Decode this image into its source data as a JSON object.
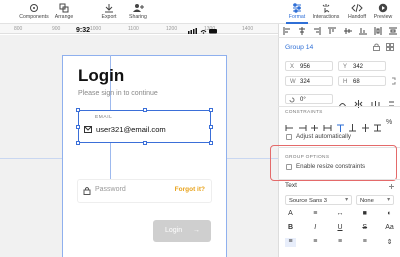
{
  "toolbar": {
    "items": [
      {
        "label": "Components",
        "icon": "components-icon"
      },
      {
        "label": "Arrange",
        "icon": "arrange-icon"
      },
      {
        "label": "Export",
        "icon": "export-icon"
      },
      {
        "label": "Sharing",
        "icon": "sharing-icon"
      },
      {
        "label": "Format",
        "icon": "format-icon"
      },
      {
        "label": "Interactions",
        "icon": "interactions-icon"
      },
      {
        "label": "Handoff",
        "icon": "handoff-icon"
      },
      {
        "label": "Preview",
        "icon": "preview-icon"
      }
    ],
    "active": "Format",
    "accent_color": "#2f6fd6"
  },
  "ruler": {
    "ticks": [
      "800",
      "900",
      "1000",
      "1100",
      "1200",
      "1300",
      "1400"
    ]
  },
  "artboard": {
    "status_time": "9:32",
    "title": "Login",
    "subtitle": "Please sign in to continue",
    "email": {
      "label": "EMAIL",
      "value": "user321@email.com"
    },
    "password": {
      "placeholder": "Password",
      "forgot_label": "Forgot it?"
    },
    "login_button": {
      "label": "Login",
      "arrow": "→"
    },
    "forgot_color": "#e8a21a"
  },
  "inspector": {
    "group_name": "Group 14",
    "x": {
      "key": "X",
      "value": "956"
    },
    "y": {
      "key": "Y",
      "value": "342"
    },
    "w": {
      "key": "W",
      "value": "324"
    },
    "h": {
      "key": "H",
      "value": "68"
    },
    "rotation": "0°",
    "constraints_label": "CONSTRAINTS",
    "adjust_label": "Adjust automatically",
    "group_options_label": "GROUP OPTIONS",
    "resize_label": "Enable resize constraints",
    "text_header": "Text",
    "font_family": "Source Sans 3",
    "font_style": "None",
    "highlight_color": "#e46a6a"
  }
}
